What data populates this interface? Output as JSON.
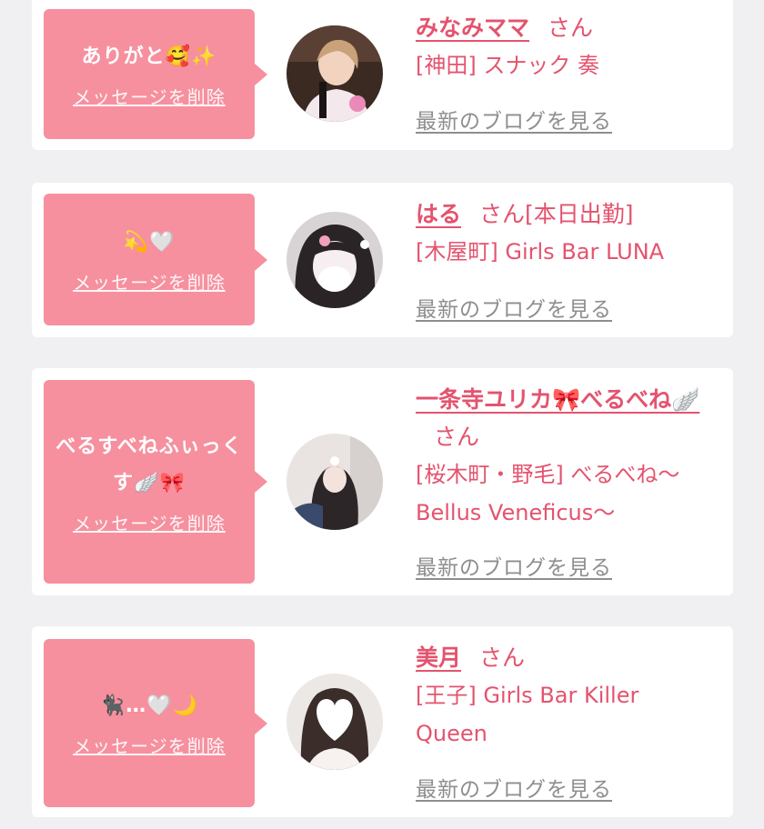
{
  "colors": {
    "accent": "#e4536e",
    "bubble": "#f6909e",
    "link_gray": "#8e8e8e",
    "background": "#f0f0f2"
  },
  "messages": [
    {
      "text": "ありがと🥰✨",
      "delete_label": "メッセージを削除",
      "name": "みなみママ",
      "honorific": "さん",
      "status": "",
      "shop": "[神田] スナック 奏",
      "blog_link": "最新のブログを見る",
      "avatar_icon": "cast-photo-icon"
    },
    {
      "text": "💫🤍",
      "delete_label": "メッセージを削除",
      "name": "はる",
      "honorific": "さん",
      "status": "[本日出勤]",
      "shop": "[木屋町] Girls Bar LUNA",
      "blog_link": "最新のブログを見る",
      "avatar_icon": "cast-photo-icon"
    },
    {
      "text": "べるすべねふぃっくす🪽🎀",
      "delete_label": "メッセージを削除",
      "name": "一条寺ユリカ🎀べるべね🪽",
      "honorific": "さん",
      "status": "",
      "shop": "[桜木町・野毛] べるべね〜Bellus Veneficus〜",
      "blog_link": "最新のブログを見る",
      "avatar_icon": "cast-photo-icon"
    },
    {
      "text": "🐈‍⬛…🤍🌙",
      "delete_label": "メッセージを削除",
      "name": "美月",
      "honorific": "さん",
      "status": "",
      "shop": "[王子] Girls Bar Killer Queen",
      "blog_link": "最新のブログを見る",
      "avatar_icon": "cast-photo-icon"
    }
  ]
}
